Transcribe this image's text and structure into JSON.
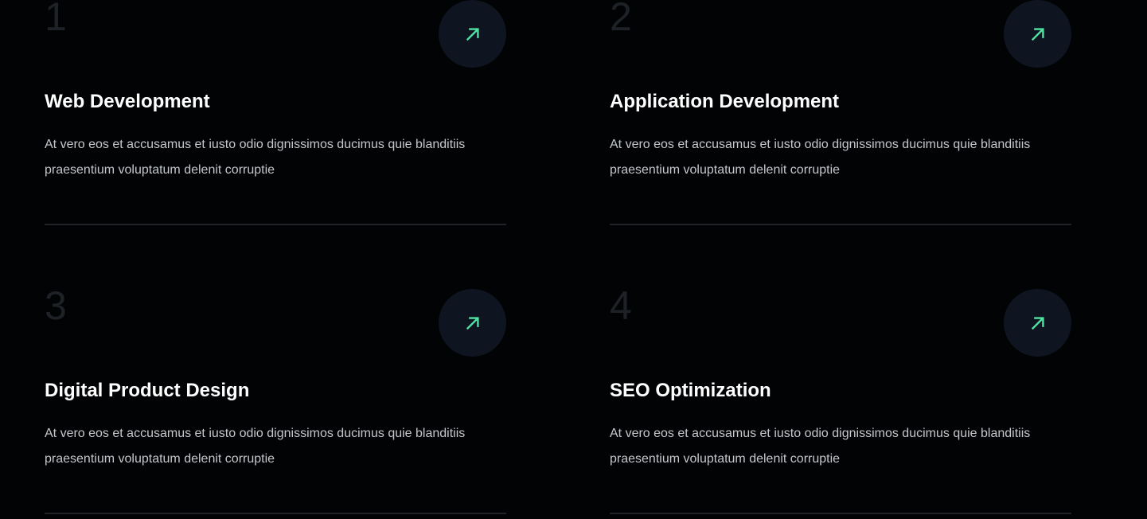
{
  "colors": {
    "background": "#020304",
    "accent": "#4fe3a1",
    "button_bg": "#0e1521",
    "number": "#1e2227",
    "divider": "#1f2327"
  },
  "services": [
    {
      "number": "1",
      "title": "Web Development",
      "description": "At vero eos et accusamus et iusto odio dignissimos ducimus quie blanditiis praesentium voluptatum delenit corruptie",
      "icon": "arrow-up-right-icon"
    },
    {
      "number": "2",
      "title": "Application Development",
      "description": "At vero eos et accusamus et iusto odio dignissimos ducimus quie blanditiis praesentium voluptatum delenit corruptie",
      "icon": "arrow-up-right-icon"
    },
    {
      "number": "3",
      "title": "Digital Product Design",
      "description": "At vero eos et accusamus et iusto odio dignissimos ducimus quie blanditiis praesentium voluptatum delenit corruptie",
      "icon": "arrow-up-right-icon"
    },
    {
      "number": "4",
      "title": "SEO Optimization",
      "description": "At vero eos et accusamus et iusto odio dignissimos ducimus quie blanditiis praesentium voluptatum delenit corruptie",
      "icon": "arrow-up-right-icon"
    }
  ]
}
